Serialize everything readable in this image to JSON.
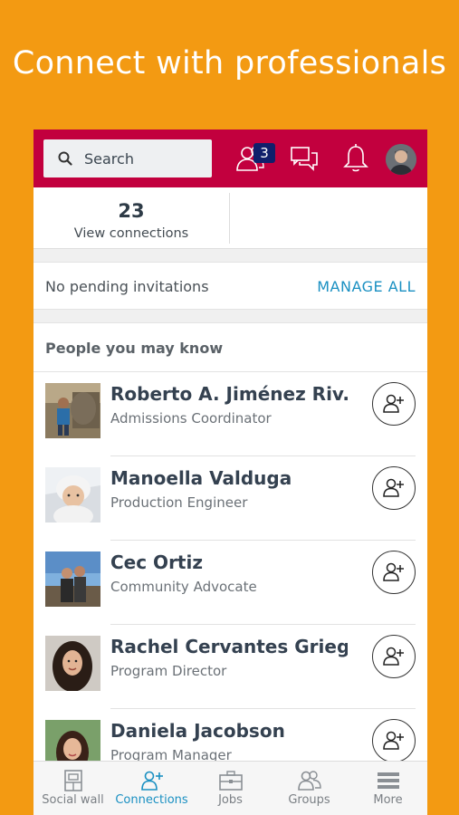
{
  "headline": "Connect with professionals",
  "topbar": {
    "search_label": "Search",
    "notif_badge": "3"
  },
  "connections": {
    "count": "23",
    "label": "View connections"
  },
  "invitations": {
    "text": "No pending invitations",
    "action": "MANAGE ALL"
  },
  "pymk": {
    "heading": "People you may know",
    "people": [
      {
        "name": "Roberto A. Jiménez Riv...",
        "title": "Admissions Coordinator"
      },
      {
        "name": "Manoella Valduga",
        "title": "Production Engineer"
      },
      {
        "name": "Cec Ortiz",
        "title": "Community Advocate"
      },
      {
        "name": "Rachel Cervantes Griego",
        "title": "Program Director"
      },
      {
        "name": "Daniela Jacobson",
        "title": "Program Manager"
      }
    ]
  },
  "nav": [
    {
      "label": "Social wall",
      "icon": "social-wall-icon"
    },
    {
      "label": "Connections",
      "icon": "connections-icon",
      "active": true
    },
    {
      "label": "Jobs",
      "icon": "briefcase-icon"
    },
    {
      "label": "Groups",
      "icon": "groups-icon"
    },
    {
      "label": "More",
      "icon": "menu-icon"
    }
  ],
  "colors": {
    "background": "#F39A12",
    "topbar": "#C2003E",
    "accent": "#1a90c2",
    "badge": "#101f6b"
  }
}
